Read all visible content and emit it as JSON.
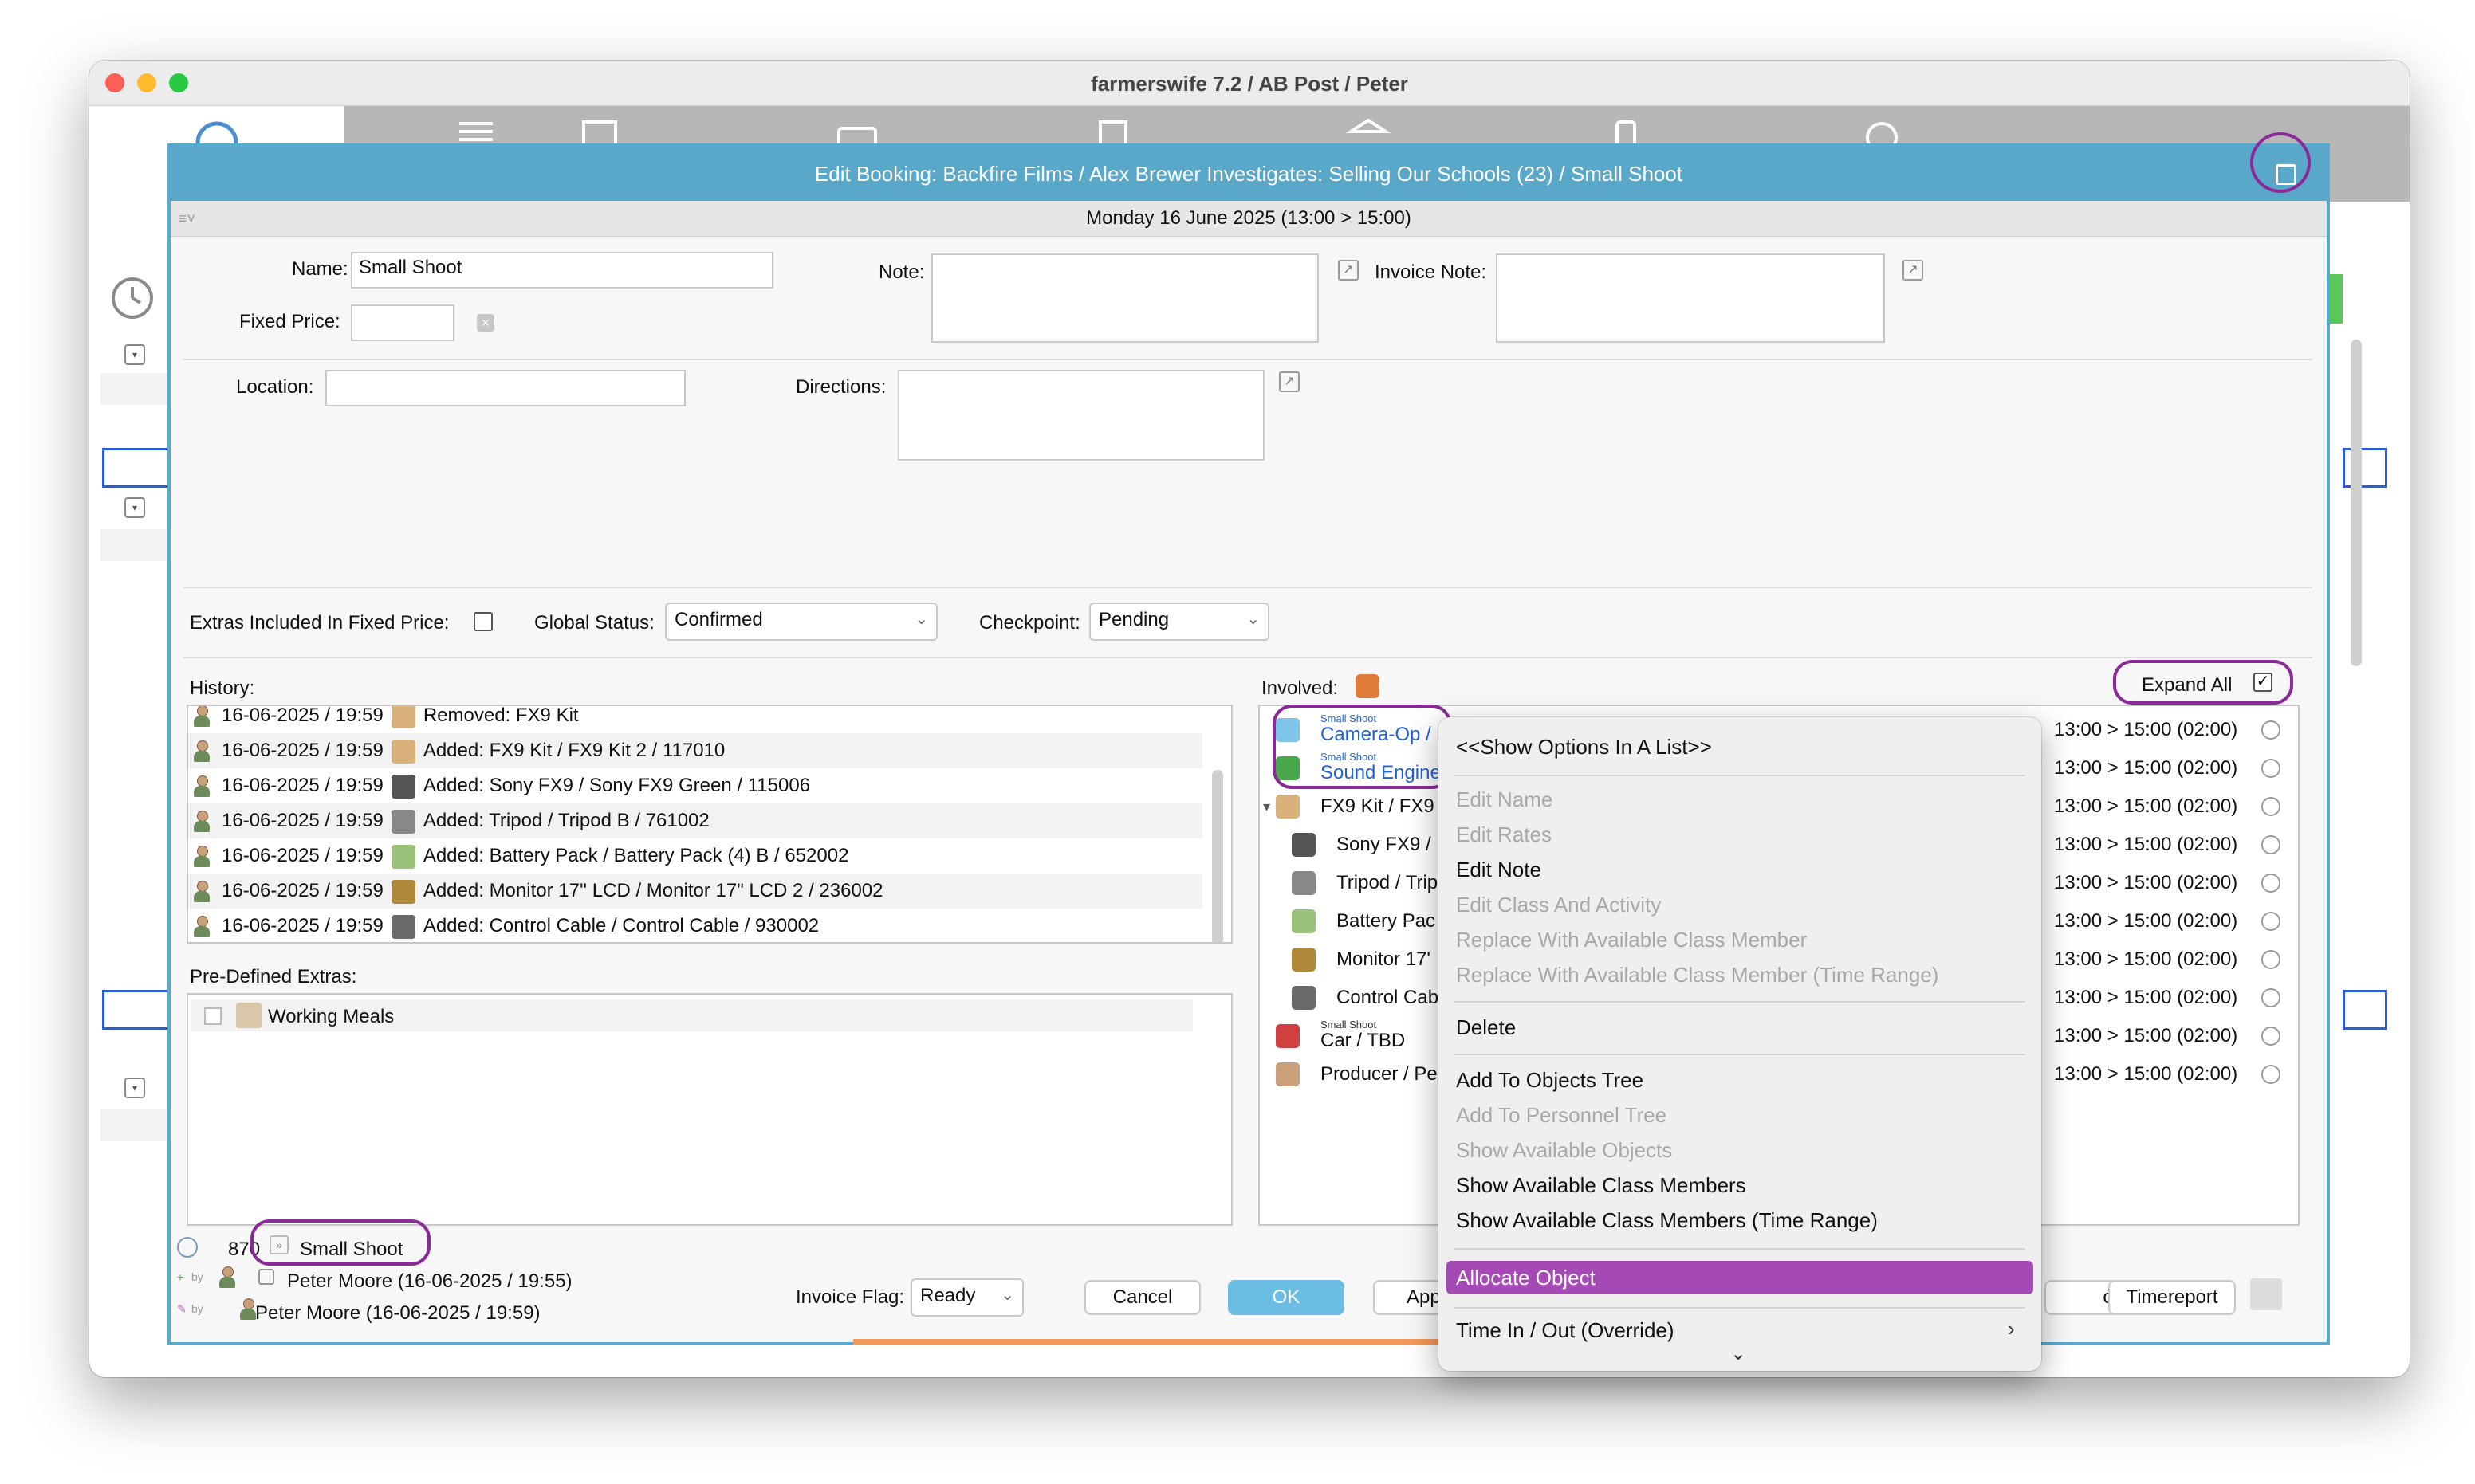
{
  "window": {
    "title": "farmerswife 7.2  / AB Post / Peter"
  },
  "dialog": {
    "title": "Edit Booking: Backfire Films / Alex Brewer Investigates: Selling Our Schools (23) / Small Shoot",
    "date_range": "Monday 16 June 2025 (13:00 > 15:00)",
    "labels": {
      "name": "Name:",
      "fixed_price": "Fixed Price:",
      "note": "Note:",
      "invoice_note": "Invoice Note:",
      "location": "Location:",
      "directions": "Directions:",
      "extras_included": "Extras Included In Fixed Price:",
      "global_status": "Global Status:",
      "checkpoint": "Checkpoint:",
      "history": "History:",
      "involved": "Involved:",
      "pre_defined_extras": "Pre-Defined Extras:",
      "invoice_flag": "Invoice Flag:",
      "expand_all": "Expand All"
    },
    "name_value": "Small Shoot",
    "global_status_value": "Confirmed",
    "checkpoint_value": "Pending",
    "invoice_flag_value": "Ready",
    "history": [
      {
        "date": "16-06-2025 / 19:59",
        "text": "Removed: FX9 Kit"
      },
      {
        "date": "16-06-2025 / 19:59",
        "text": "Added: FX9 Kit / FX9 Kit 2 / 117010"
      },
      {
        "date": "16-06-2025 / 19:59",
        "text": "Added: Sony FX9 / Sony FX9 Green / 115006"
      },
      {
        "date": "16-06-2025 / 19:59",
        "text": "Added: Tripod / Tripod B / 761002"
      },
      {
        "date": "16-06-2025 / 19:59",
        "text": "Added: Battery Pack / Battery Pack (4) B / 652002"
      },
      {
        "date": "16-06-2025 / 19:59",
        "text": "Added: Monitor 17'' LCD / Monitor 17\" LCD 2 / 236002"
      },
      {
        "date": "16-06-2025 / 19:59",
        "text": "Added: Control Cable / Control Cable / 930002"
      }
    ],
    "extras": [
      {
        "label": "Working Meals"
      }
    ],
    "involved": [
      {
        "tag": "Small Shoot",
        "label": "Camera-Op /",
        "time": "13:00 > 15:00 (02:00)"
      },
      {
        "tag": "Small Shoot",
        "label": "Sound Engine",
        "time": "13:00 > 15:00 (02:00)"
      },
      {
        "tag": "",
        "label": "FX9 Kit / FX9",
        "time": "13:00 > 15:00 (02:00)"
      },
      {
        "tag": "",
        "label": "Sony FX9 /",
        "time": "13:00 > 15:00 (02:00)"
      },
      {
        "tag": "",
        "label": "Tripod / Trip",
        "time": "13:00 > 15:00 (02:00)"
      },
      {
        "tag": "",
        "label": "Battery Pac",
        "time": "13:00 > 15:00 (02:00)"
      },
      {
        "tag": "",
        "label": "Monitor 17'",
        "time": "13:00 > 15:00 (02:00)"
      },
      {
        "tag": "",
        "label": "Control Cab",
        "time": "13:00 > 15:00 (02:00)"
      },
      {
        "tag": "Small Shoot",
        "label": "Car / TBD",
        "time": "13:00 > 15:00 (02:00)"
      },
      {
        "tag": "",
        "label": "Producer / Pe",
        "time": "13:00 > 15:00 (02:00)"
      }
    ],
    "footer": {
      "booking_number": "870",
      "booking_name": "Small Shoot",
      "created_by": "Peter Moore (16-06-2025 / 19:55)",
      "modified_by": "Peter Moore (16-06-2025 / 19:59)",
      "by_label": "by"
    },
    "buttons": {
      "cancel": "Cancel",
      "ok": "OK",
      "apply_partial": "App",
      "partial_right": "ct",
      "timereport": "Timereport"
    }
  },
  "context_menu": {
    "items": [
      {
        "label": "<<Show Options In A List>>",
        "disabled": false
      },
      {
        "label": "Edit Name",
        "disabled": true
      },
      {
        "label": "Edit Rates",
        "disabled": true
      },
      {
        "label": "Edit Note",
        "disabled": false
      },
      {
        "label": "Edit Class And Activity",
        "disabled": true
      },
      {
        "label": "Replace With Available Class Member",
        "disabled": true
      },
      {
        "label": "Replace With Available Class Member (Time Range)",
        "disabled": true
      },
      {
        "label": "Delete",
        "disabled": false
      },
      {
        "label": "Add To Objects Tree",
        "disabled": false
      },
      {
        "label": "Add To Personnel Tree",
        "disabled": true
      },
      {
        "label": "Show Available Objects",
        "disabled": true
      },
      {
        "label": "Show Available Class Members",
        "disabled": false
      },
      {
        "label": "Show Available Class Members (Time Range)",
        "disabled": false
      },
      {
        "label": "Allocate Object",
        "disabled": false,
        "highlighted": true
      },
      {
        "label": "Time In / Out (Override)",
        "disabled": false,
        "submenu": true
      }
    ],
    "highlight_color": "#a549b5"
  },
  "colors": {
    "dialog_header": "#5aa8c9",
    "ok_button": "#6bbde3",
    "annotation": "#8a2a98"
  }
}
